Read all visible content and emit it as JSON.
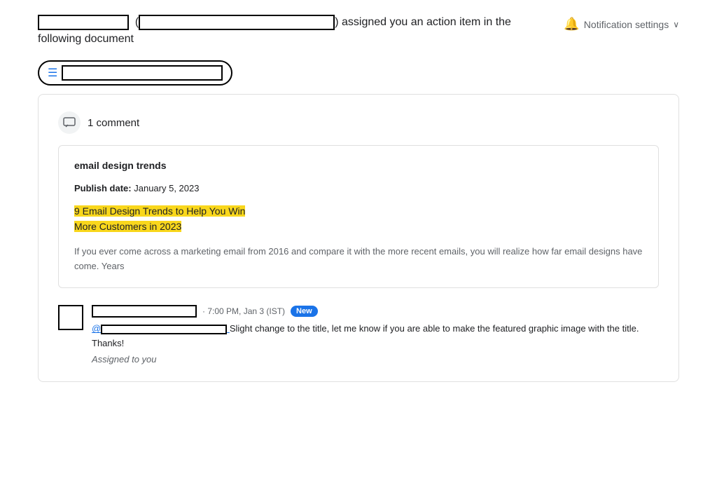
{
  "header": {
    "assignment_text_part1": "assigned you an action item in the",
    "assignment_text_part2": "following document",
    "notification_label": "Notification settings"
  },
  "toolbar": {
    "doc_icon": "☰"
  },
  "comments_section": {
    "count_label": "1 comment",
    "doc_preview": {
      "title": "email design trends",
      "publish_date_label": "Publish date: ",
      "publish_date_value": "January 5, 2023",
      "highlighted_title_line1": "9 Email Design Trends to Help You Win",
      "highlighted_title_line2": "More Customers in 2023",
      "preview_text": "If you ever come across a marketing email from 2016 and compare it with the more recent emails, you will realize how far email designs have come. Years"
    },
    "comment": {
      "time": "· 7:00 PM, Jan 3 (IST)",
      "new_badge": "New",
      "comment_text_prefix": "@",
      "comment_text_body": " Slight change to the title, let me know if you are able to make the featured graphic image with the title. Thanks!",
      "assigned_label": "Assigned to you"
    }
  },
  "icons": {
    "bell": "🔔",
    "chevron_down": "∨",
    "doc": "☰",
    "comment": "💬"
  }
}
